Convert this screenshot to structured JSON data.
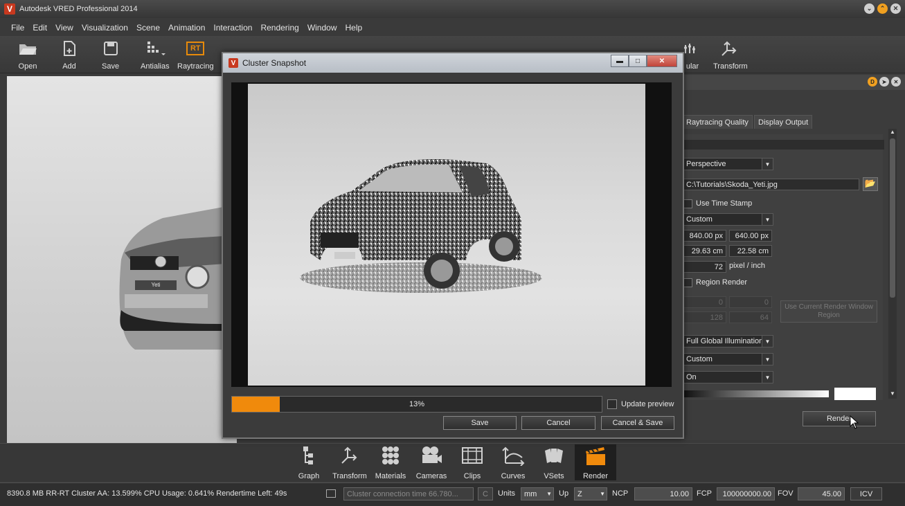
{
  "window": {
    "title": "Autodesk VRED Professional 2014",
    "logo": "V",
    "controls": [
      "minimize-icon",
      "restore-icon",
      "close-icon"
    ]
  },
  "menu": [
    "File",
    "Edit",
    "View",
    "Visualization",
    "Scene",
    "Animation",
    "Interaction",
    "Rendering",
    "Window",
    "Help"
  ],
  "toolbar": {
    "open": "Open",
    "add": "Add",
    "save": "Save",
    "antialias": "Antialias",
    "raytracing": "Raytracing",
    "raytracing_icon": "RT",
    "specular_partial": "ular",
    "transform": "Transform"
  },
  "panel": {
    "tabs": [
      "Raytracing Quality",
      "Display Output"
    ],
    "camera_mode": "Perspective",
    "file_path": "C:\\Tutorials\\Skoda_Yeti.jpg",
    "use_time_stamp": "Use Time Stamp",
    "size_preset": "Custom",
    "width_px": "840.00 px",
    "height_px": "640.00 px",
    "width_cm": "29.63 cm",
    "height_cm": "22.58 cm",
    "dpi": "72",
    "dpi_unit": "pixel / inch",
    "region_render": "Region Render",
    "region_x": "0",
    "region_y": "0",
    "region_w": "128",
    "region_h": "64",
    "use_current_region": "Use Current Render Window Region",
    "illumination": "Full Global Illumination",
    "quality_preset": "Custom",
    "toggle": "On",
    "render_button": "Render"
  },
  "dialog": {
    "title": "Cluster Snapshot",
    "progress": 0.13,
    "progress_label": "13%",
    "update_preview": "Update preview",
    "save": "Save",
    "cancel": "Cancel",
    "cancel_save": "Cancel & Save"
  },
  "dock": [
    "Graph",
    "Transform",
    "Materials",
    "Cameras",
    "Clips",
    "Curves",
    "VSets",
    "Render"
  ],
  "status": {
    "info": "8390.8 MB  RR-RT Cluster AA: 13.599% CPU Usage: 0.641% Rendertime Left: 49s",
    "cluster_msg": "Cluster connection time 66.780...",
    "c_button": "C",
    "units_label": "Units",
    "units_value": "mm",
    "up_label": "Up",
    "up_value": "Z",
    "ncp_label": "NCP",
    "ncp_value": "10.00",
    "fcp_label": "FCP",
    "fcp_value": "100000000.00",
    "fov_label": "FOV",
    "fov_value": "45.00",
    "icv": "ICV"
  },
  "viewport": {
    "plate": "Yeti"
  },
  "colors": {
    "accent": "#f08a0c",
    "brand": "#c8391f"
  }
}
